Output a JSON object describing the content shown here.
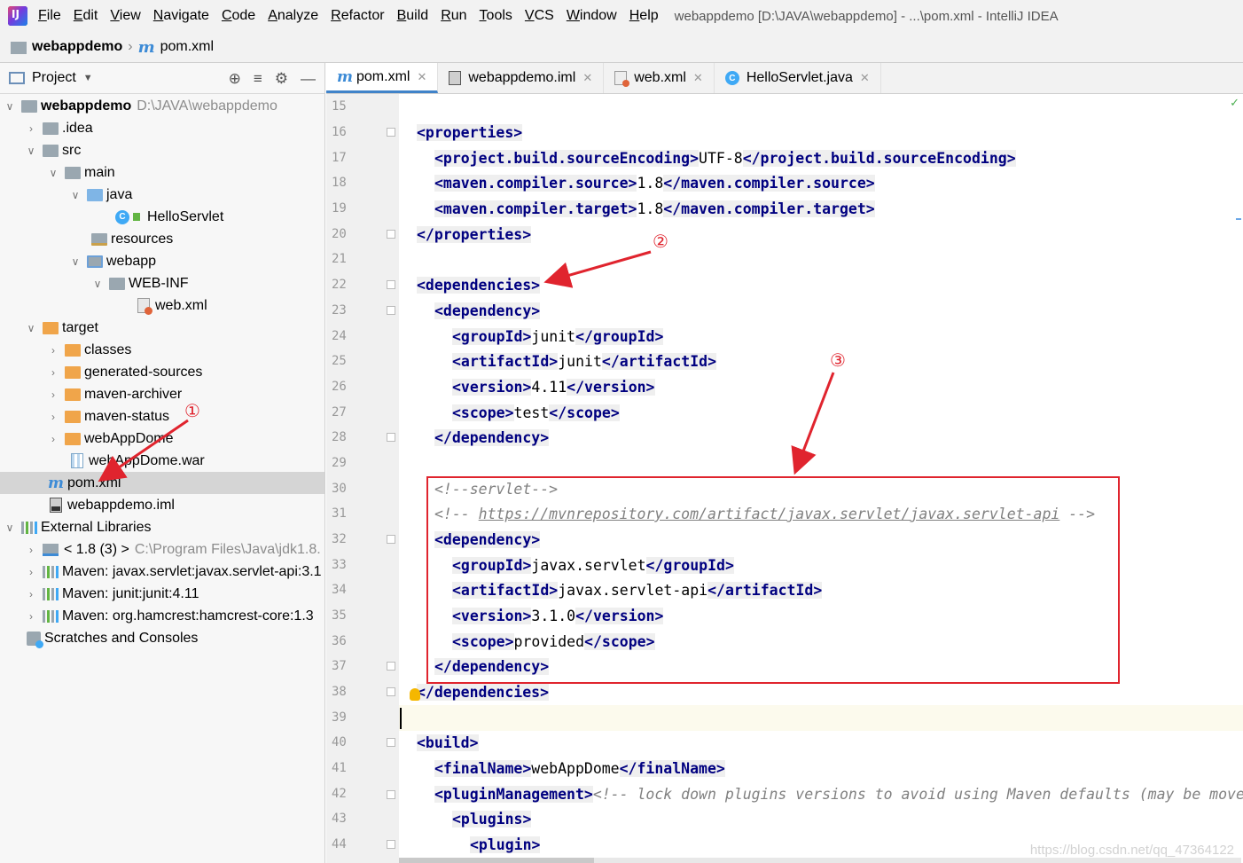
{
  "menu": {
    "items": [
      "File",
      "Edit",
      "View",
      "Navigate",
      "Code",
      "Analyze",
      "Refactor",
      "Build",
      "Run",
      "Tools",
      "VCS",
      "Window",
      "Help"
    ],
    "window_title": "webappdemo [D:\\JAVA\\webappdemo] - ...\\pom.xml - IntelliJ IDEA"
  },
  "breadcrumb": {
    "project": "webappdemo",
    "file": "pom.xml"
  },
  "project_panel": {
    "title": "Project",
    "tree": {
      "root": "webappdemo",
      "root_path": "D:\\JAVA\\webappdemo",
      "idea": ".idea",
      "src": "src",
      "main": "main",
      "java": "java",
      "hello": "HelloServlet",
      "resources": "resources",
      "webapp": "webapp",
      "webinf": "WEB-INF",
      "webxml": "web.xml",
      "target": "target",
      "classes": "classes",
      "gensrc": "generated-sources",
      "archiver": "maven-archiver",
      "status": "maven-status",
      "webappdome": "webAppDome",
      "war": "webAppDome.war",
      "pom": "pom.xml",
      "iml": "webappdemo.iml",
      "extlib": "External Libraries",
      "jdk": "< 1.8 (3) >",
      "jdk_path": "C:\\Program Files\\Java\\jdk1.8.",
      "lib1": "Maven: javax.servlet:javax.servlet-api:3.1",
      "lib2": "Maven: junit:junit:4.11",
      "lib3": "Maven: org.hamcrest:hamcrest-core:1.3",
      "scratch": "Scratches and Consoles"
    }
  },
  "tabs": [
    {
      "label": "pom.xml",
      "active": true
    },
    {
      "label": "webappdemo.iml",
      "active": false
    },
    {
      "label": "web.xml",
      "active": false
    },
    {
      "label": "HelloServlet.java",
      "active": false
    }
  ],
  "editor": {
    "line_numbers": [
      "15",
      "16",
      "17",
      "18",
      "19",
      "20",
      "21",
      "22",
      "23",
      "24",
      "25",
      "26",
      "27",
      "28",
      "29",
      "30",
      "31",
      "32",
      "33",
      "34",
      "35",
      "36",
      "37",
      "38",
      "39",
      "40",
      "41",
      "42",
      "43",
      "44"
    ],
    "code": {
      "l16a": "<properties>",
      "l17a": "<project.build.sourceEncoding>",
      "l17b": "UTF-8",
      "l17c": "</project.build.sourceEncoding>",
      "l18a": "<maven.compiler.source>",
      "l18b": "1.8",
      "l18c": "</maven.compiler.source>",
      "l19a": "<maven.compiler.target>",
      "l19b": "1.8",
      "l19c": "</maven.compiler.target>",
      "l20a": "</properties>",
      "l22a": "<dependencies>",
      "l23a": "<dependency>",
      "l24a": "<groupId>",
      "l24b": "junit",
      "l24c": "</groupId>",
      "l25a": "<artifactId>",
      "l25b": "junit",
      "l25c": "</artifactId>",
      "l26a": "<version>",
      "l26b": "4.11",
      "l26c": "</version>",
      "l27a": "<scope>",
      "l27b": "test",
      "l27c": "</scope>",
      "l28a": "</dependency>",
      "l30a": "<!--servlet-->",
      "l31a": "<!-- ",
      "l31b": "https://mvnrepository.com/artifact/javax.servlet/javax.servlet-api",
      "l31c": " -->",
      "l32a": "<dependency>",
      "l33a": "<groupId>",
      "l33b": "javax.servlet",
      "l33c": "</groupId>",
      "l34a": "<artifactId>",
      "l34b": "javax.servlet-api",
      "l34c": "</artifactId>",
      "l35a": "<version>",
      "l35b": "3.1.0",
      "l35c": "</version>",
      "l36a": "<scope>",
      "l36b": "provided",
      "l36c": "</scope>",
      "l37a": "</dependency>",
      "l38a": "</dependencies>",
      "l40a": "<build>",
      "l41a": "<finalName>",
      "l41b": "webAppDome",
      "l41c": "</finalName>",
      "l42a": "<pluginManagement>",
      "l42b": "<!-- lock down plugins versions to avoid using Maven defaults (may be move",
      "l43a": "<plugins>",
      "l44a": "<plugin>"
    }
  },
  "annotations": {
    "one": "①",
    "two": "②",
    "three": "③",
    "color": "#e0242e"
  },
  "watermark": "https://blog.csdn.net/qq_47364122"
}
